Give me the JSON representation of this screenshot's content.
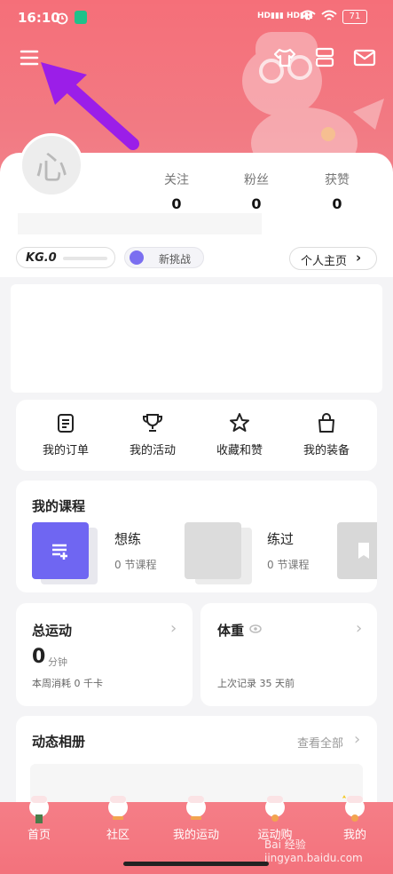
{
  "status": {
    "time": "16:10",
    "battery": "71"
  },
  "profile": {
    "avatar_char": "心",
    "stats": [
      {
        "label": "关注",
        "value": "0"
      },
      {
        "label": "粉丝",
        "value": "0"
      },
      {
        "label": "获赞",
        "value": "0"
      }
    ],
    "level": "KG.0",
    "challenge": "新挑战",
    "homepage": "个人主页"
  },
  "quick_actions": [
    {
      "label": "我的订单",
      "icon": "clipboard-icon"
    },
    {
      "label": "我的活动",
      "icon": "trophy-icon"
    },
    {
      "label": "收藏和赞",
      "icon": "star-icon"
    },
    {
      "label": "我的装备",
      "icon": "bag-icon"
    }
  ],
  "courses": {
    "title": "我的课程",
    "items": [
      {
        "name": "想练",
        "count": "0 节课程"
      },
      {
        "name": "练过",
        "count": "0 节课程"
      }
    ]
  },
  "exercise": {
    "title": "总运动",
    "value": "0",
    "unit": "分钟",
    "note": "本周消耗 0 千卡"
  },
  "weight": {
    "title": "体重",
    "note": "上次记录 35 天前"
  },
  "album": {
    "title": "动态相册",
    "view_all": "查看全部"
  },
  "tabs": [
    "首页",
    "社区",
    "我的运动",
    "运动购",
    "我的"
  ],
  "watermark": "Bai 经验 jingyan.baidu.com",
  "colors": {
    "accent": "#f56f79",
    "course_purple": "#6f66f2",
    "arrow": "#9b1ee8"
  }
}
